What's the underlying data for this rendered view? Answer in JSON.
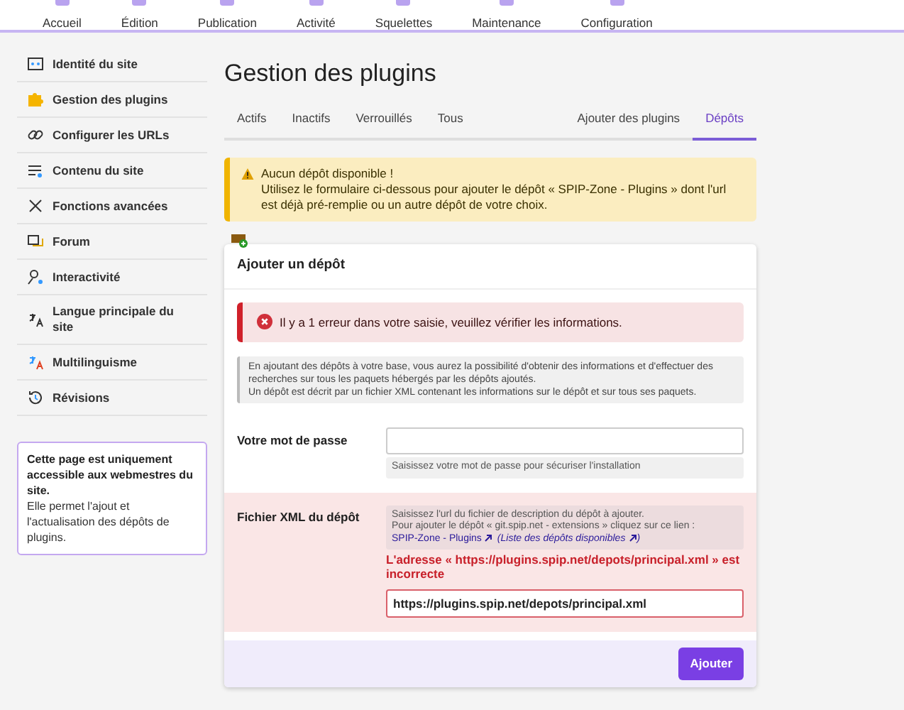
{
  "top_nav": [
    {
      "label": "Accueil"
    },
    {
      "label": "Édition"
    },
    {
      "label": "Publication"
    },
    {
      "label": "Activité"
    },
    {
      "label": "Squelettes"
    },
    {
      "label": "Maintenance"
    },
    {
      "label": "Configuration"
    }
  ],
  "sidebar": {
    "items": [
      {
        "label": "Identité du site",
        "kind": "identity"
      },
      {
        "label": "Gestion des plugins",
        "kind": "puzzle"
      },
      {
        "label": "Configurer les URLs",
        "kind": "link"
      },
      {
        "label": "Contenu du site",
        "kind": "content"
      },
      {
        "label": "Fonctions avancées",
        "kind": "tools"
      },
      {
        "label": "Forum",
        "kind": "forum"
      },
      {
        "label": "Interactivité",
        "kind": "user"
      },
      {
        "label": "Langue principale du site",
        "kind": "lang"
      },
      {
        "label": "Multilinguisme",
        "kind": "multilang"
      },
      {
        "label": "Révisions",
        "kind": "history"
      }
    ],
    "info": {
      "title": "Cette page est uniquement accessible aux webmestres du site.",
      "text": "Elle permet l'ajout et l'actualisation des dépôts de plugins."
    }
  },
  "page_title": "Gestion des plugins",
  "tabs": [
    {
      "label": "Actifs",
      "selected": false
    },
    {
      "label": "Inactifs",
      "selected": false
    },
    {
      "label": "Verrouillés",
      "selected": false
    },
    {
      "label": "Tous",
      "selected": false
    }
  ],
  "tabs_right": [
    {
      "label": "Ajouter des plugins",
      "selected": false
    },
    {
      "label": "Dépôts",
      "selected": true
    }
  ],
  "warning": {
    "title": "Aucun dépôt disponible !",
    "text": "Utilisez le formulaire ci-dessous pour ajouter le dépôt « SPIP-Zone - Plugins » dont l'url est déjà pré-remplie ou un autre dépôt de votre choix."
  },
  "form": {
    "title": "Ajouter un dépôt",
    "error": "Il y a 1 erreur dans votre saisie, veuillez vérifier les informations.",
    "explanation": [
      "En ajoutant des dépôts à votre base, vous aurez la possibilité d'obtenir des informations et d'effectuer des recherches sur tous les paquets hébergés par les dépôts ajoutés.",
      "Un dépôt est décrit par un fichier XML contenant les informations sur le dépôt et sur tous ses paquets."
    ],
    "fields": [
      {
        "label": "Votre mot de passe",
        "kind": "password",
        "help_after": "Saisissez votre mot de passe pour sécuriser l'installation",
        "error": false
      },
      {
        "label": "Fichier XML du dépôt",
        "kind": "url",
        "help_before": [
          "Saisissez l'url du fichier de description du dépôt à ajouter.",
          "Pour ajouter le dépôt « git.spip.net - extensions » cliquez sur ce lien :"
        ],
        "link": "SPIP-Zone - Plugins",
        "link2": "(Liste des dépôts disponibles",
        "link2_end": ")",
        "error": true,
        "error_text": "L'adresse « https://plugins.spip.net/depots/principal.xml » est incorrecte",
        "value": "https://plugins.spip.net/depots/principal.xml"
      }
    ],
    "submit": "Ajouter"
  }
}
